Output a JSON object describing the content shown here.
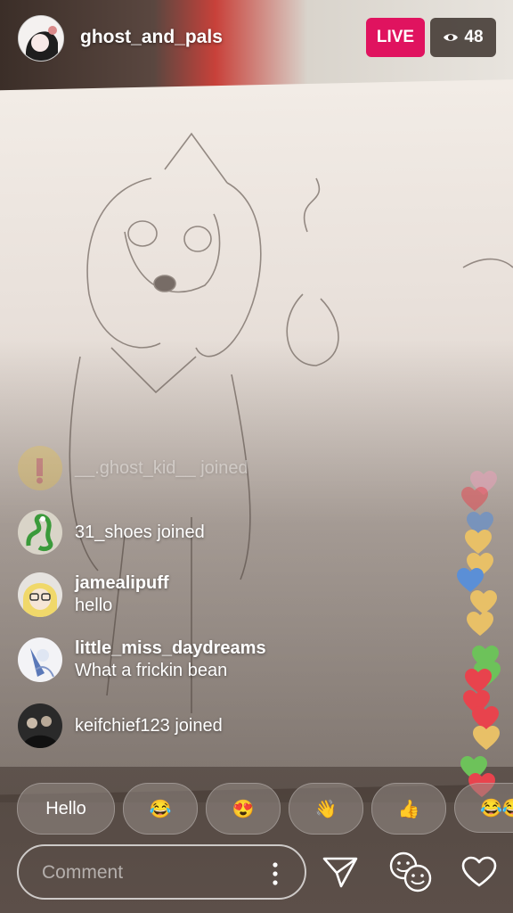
{
  "header": {
    "host_name": "ghost_and_pals",
    "live_label": "LIVE",
    "viewer_count": "48"
  },
  "comments": [
    {
      "type": "joined",
      "user": "__.ghost_kid__",
      "joined_label": "joined",
      "faded": true
    },
    {
      "type": "joined",
      "user": "31_shoes",
      "joined_label": "joined"
    },
    {
      "type": "message",
      "user": "jamealipuff",
      "text": "hello"
    },
    {
      "type": "message",
      "user": "little_miss_daydreams",
      "text": "What a frickin bean"
    },
    {
      "type": "joined",
      "user": "keifchief123",
      "joined_label": "joined"
    }
  ],
  "quick_replies": [
    "Hello",
    "😂",
    "😍",
    "👋",
    "👍",
    "😂😂"
  ],
  "composer": {
    "placeholder": "Comment"
  },
  "icons": [
    "eye-icon",
    "kebab-menu-icon",
    "send-icon",
    "face-filter-icon",
    "heart-icon"
  ],
  "colors": {
    "live": "#e0135f",
    "heart_pink": "#e9a0b8",
    "heart_gold": "#e8c067",
    "heart_green": "#6dc25a",
    "heart_red": "#e8434d",
    "heart_blue": "#5b8fd6"
  }
}
